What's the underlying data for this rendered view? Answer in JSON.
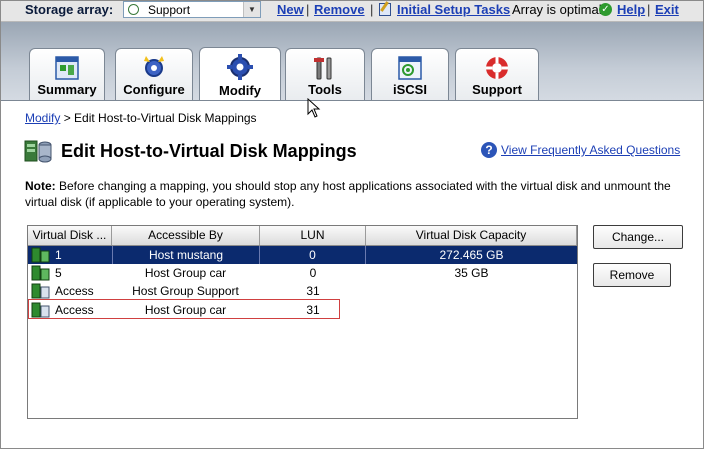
{
  "topbar": {
    "storage_array_label": "Storage array:",
    "storage_array_value": "Support",
    "links": {
      "new": "New",
      "remove": "Remove",
      "initial_setup": "Initial Setup Tasks",
      "help": "Help",
      "exit": "Exit"
    },
    "separator": "|",
    "status_text": "Array is optimal"
  },
  "tabs": [
    {
      "label": "Summary",
      "icon": "summary-icon"
    },
    {
      "label": "Configure",
      "icon": "configure-icon"
    },
    {
      "label": "Modify",
      "icon": "modify-icon",
      "active": true
    },
    {
      "label": "Tools",
      "icon": "tools-icon"
    },
    {
      "label": "iSCSI",
      "icon": "iscsi-icon"
    },
    {
      "label": "Support",
      "icon": "support-icon"
    }
  ],
  "breadcrumb": {
    "parent": "Modify",
    "separator": ">",
    "current": "Edit Host-to-Virtual Disk Mappings"
  },
  "page": {
    "title": "Edit Host-to-Virtual Disk Mappings",
    "faq_link": "View Frequently Asked Questions",
    "note_label": "Note:",
    "note_text": " Before changing a mapping, you should stop any host applications associated with the virtual disk and unmount the virtual disk (if applicable to your operating system)."
  },
  "table": {
    "columns": [
      "Virtual Disk ...",
      "Accessible By",
      "LUN",
      "Virtual Disk Capacity"
    ],
    "rows": [
      {
        "vdisk": "1",
        "accessible_by": "Host mustang",
        "lun": "0",
        "capacity": "272.465 GB",
        "selected": true
      },
      {
        "vdisk": "5",
        "accessible_by": "Host Group car",
        "lun": "0",
        "capacity": "35 GB"
      },
      {
        "vdisk": "Access",
        "accessible_by": "Host Group Support",
        "lun": "31",
        "capacity": ""
      },
      {
        "vdisk": "Access",
        "accessible_by": "Host Group car",
        "lun": "31",
        "capacity": "",
        "highlighted": true
      }
    ]
  },
  "buttons": {
    "change": "Change...",
    "remove": "Remove"
  },
  "colors": {
    "link": "#1c3fb5",
    "selection": "#0b2a6e",
    "highlight_border": "#d04040"
  }
}
